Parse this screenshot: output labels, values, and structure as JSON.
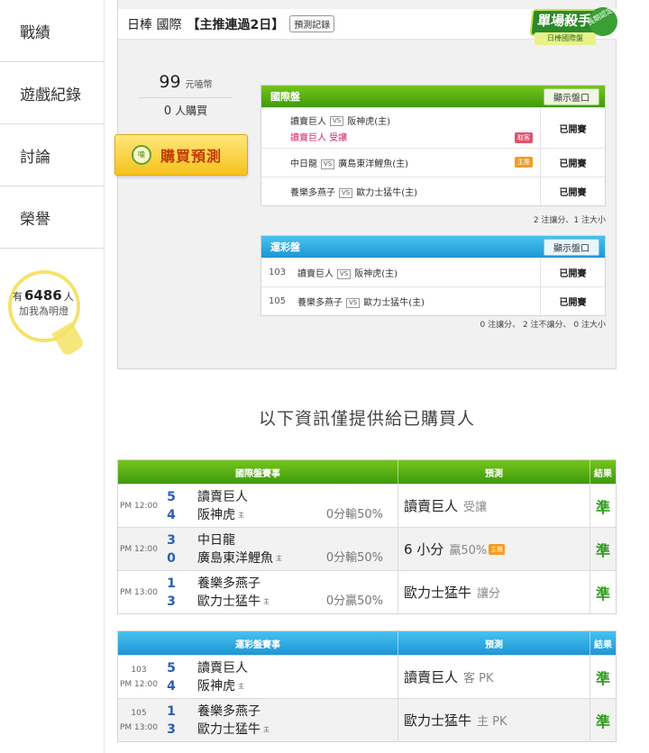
{
  "nav": {
    "items": [
      "戰績",
      "遊戲紀錄",
      "討論",
      "榮譽"
    ],
    "fans": {
      "prefix": "有",
      "count": "6486",
      "suffix": "人",
      "caption": "加我為明燈"
    }
  },
  "header": {
    "prefix": "日棒 國際",
    "title": "【主推連過2日】",
    "history_button": "預測記錄",
    "badge_main": "單場殺手",
    "badge_sub": "日棒國際盤",
    "badge_ribbon": "長期認定"
  },
  "purchase": {
    "price": "99",
    "price_unit": "元嗑幣",
    "buyers_count": "0",
    "buyers_label": "人購買",
    "buy_button": "購買預測",
    "coin_icon_text": "嗑"
  },
  "intl_panel": {
    "title": "國際盤",
    "show_button": "顯示盤口",
    "rows": [
      {
        "away": "讀賣巨人",
        "home": "阪神虎(主)",
        "pick": "讀賣巨人 受讓",
        "tag": "取客",
        "status": "已開賽"
      },
      {
        "away": "中日龍",
        "home": "廣島東洋鯉魚(主)",
        "pick": "",
        "tag": "主推",
        "status": "已開賽"
      },
      {
        "away": "養樂多燕子",
        "home": "歐力士猛牛(主)",
        "pick": "",
        "tag": "",
        "status": "已開賽"
      }
    ],
    "summary": "2 注讓分、1 注大小"
  },
  "sports_panel": {
    "title": "運彩盤",
    "show_button": "顯示盤口",
    "rows": [
      {
        "code": "103",
        "away": "讀賣巨人",
        "home": "阪神虎(主)",
        "status": "已開賽"
      },
      {
        "code": "105",
        "away": "養樂多燕子",
        "home": "歐力士猛牛(主)",
        "status": "已開賽"
      }
    ],
    "summary": "0 注讓分、 2 注不讓分、 0 注大小"
  },
  "notice": "以下資訊僅提供給已購買人",
  "intl_table": {
    "headers": [
      "國際盤賽事",
      "預測",
      "結果"
    ],
    "rows": [
      {
        "time": "PM 12:00",
        "away_score": "5",
        "home_score": "4",
        "away": "讀賣巨人",
        "home": "阪神虎",
        "line": "0分輸50%",
        "pred_main": "讀賣巨人",
        "pred_sub": "受讓",
        "pred_tag": "",
        "result": "準"
      },
      {
        "time": "PM 12:00",
        "away_score": "3",
        "home_score": "0",
        "away": "中日龍",
        "home": "廣島東洋鯉魚",
        "line": "0分輸50%",
        "pred_main": "6 小分",
        "pred_sub": "贏50%",
        "pred_tag": "主推",
        "result": "準"
      },
      {
        "time": "PM 13:00",
        "away_score": "1",
        "home_score": "3",
        "away": "養樂多燕子",
        "home": "歐力士猛牛",
        "line": "0分贏50%",
        "pred_main": "歐力士猛牛",
        "pred_sub": "讓分",
        "pred_tag": "",
        "result": "準"
      }
    ]
  },
  "sports_table": {
    "headers": [
      "運彩盤賽事",
      "預測",
      "結果"
    ],
    "rows": [
      {
        "code": "103",
        "time": "PM 12:00",
        "away_score": "5",
        "home_score": "4",
        "away": "讀賣巨人",
        "home": "阪神虎",
        "pred_main": "讀賣巨人",
        "pred_sub": "客 PK",
        "result": "準"
      },
      {
        "code": "105",
        "time": "PM 13:00",
        "away_score": "1",
        "home_score": "3",
        "away": "養樂多燕子",
        "home": "歐力士猛牛",
        "pred_main": "歐力士猛牛",
        "pred_sub": "主 PK",
        "result": "準"
      }
    ]
  },
  "host_mark": "主",
  "vs_label": "VS",
  "colors": {
    "green": "#3f9a0c",
    "blue": "#1d96d6",
    "pink": "#d6226f",
    "score_blue": "#2c5fb3",
    "result_green": "#2e9a1b"
  }
}
